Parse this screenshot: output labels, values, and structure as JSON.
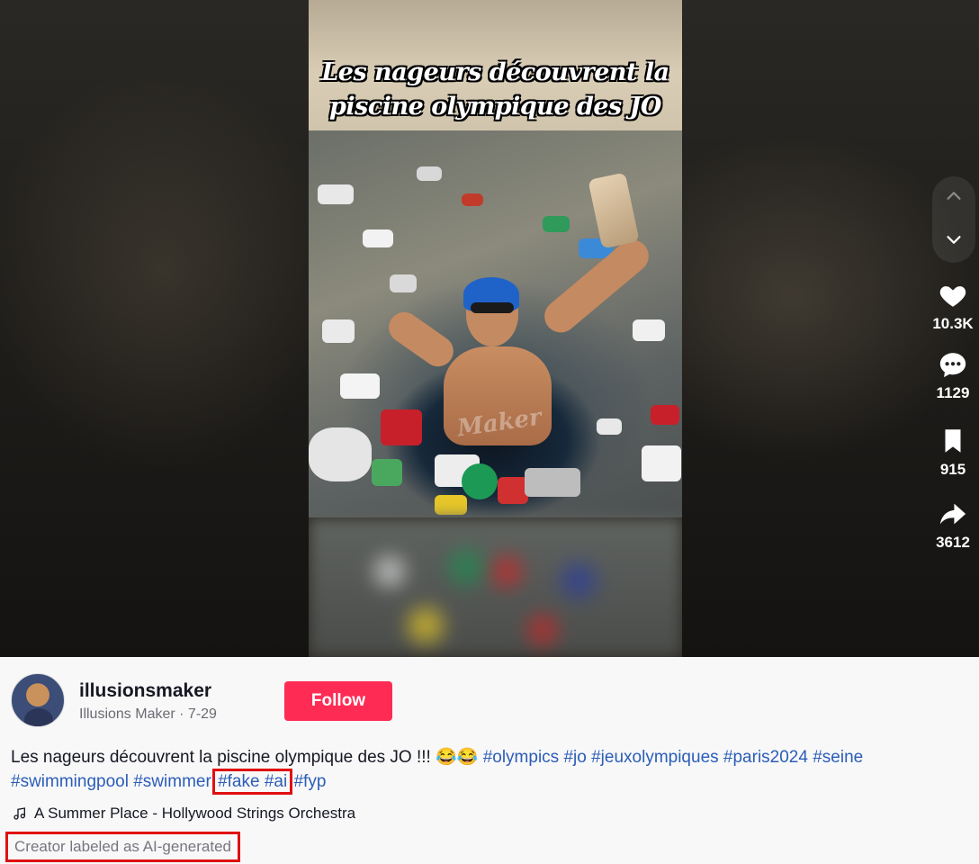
{
  "video": {
    "overlay_title_line1": "Les nageurs découvrent la",
    "overlay_title_line2": "piscine olympique des JO",
    "watermark": "Maker"
  },
  "actions": {
    "likes": "10.3K",
    "comments": "1129",
    "saves": "915",
    "shares": "3612"
  },
  "author": {
    "username": "illusionsmaker",
    "display_name": "Illusions Maker",
    "separator": " · ",
    "date": "7-29",
    "follow_label": "Follow"
  },
  "caption": {
    "text": "Les nageurs découvrent la piscine olympique des JO !!! 😂😂",
    "tags_line1": [
      "#olympics",
      "#jo",
      "#jeuxolympiques",
      "#paris2024",
      "#seine"
    ],
    "tags_line2_before": [
      "#swimmingpool",
      "#swimmer"
    ],
    "tags_highlighted": [
      "#fake",
      "#ai"
    ],
    "tags_line2_after": [
      "#fyp"
    ]
  },
  "music": {
    "title": "A Summer Place - Hollywood Strings Orchestra"
  },
  "ai_label": "Creator labeled as AI-generated",
  "colors": {
    "follow_bg": "#fe2c55",
    "hashtag": "#2b5db8",
    "highlight_box": "#e01010"
  }
}
